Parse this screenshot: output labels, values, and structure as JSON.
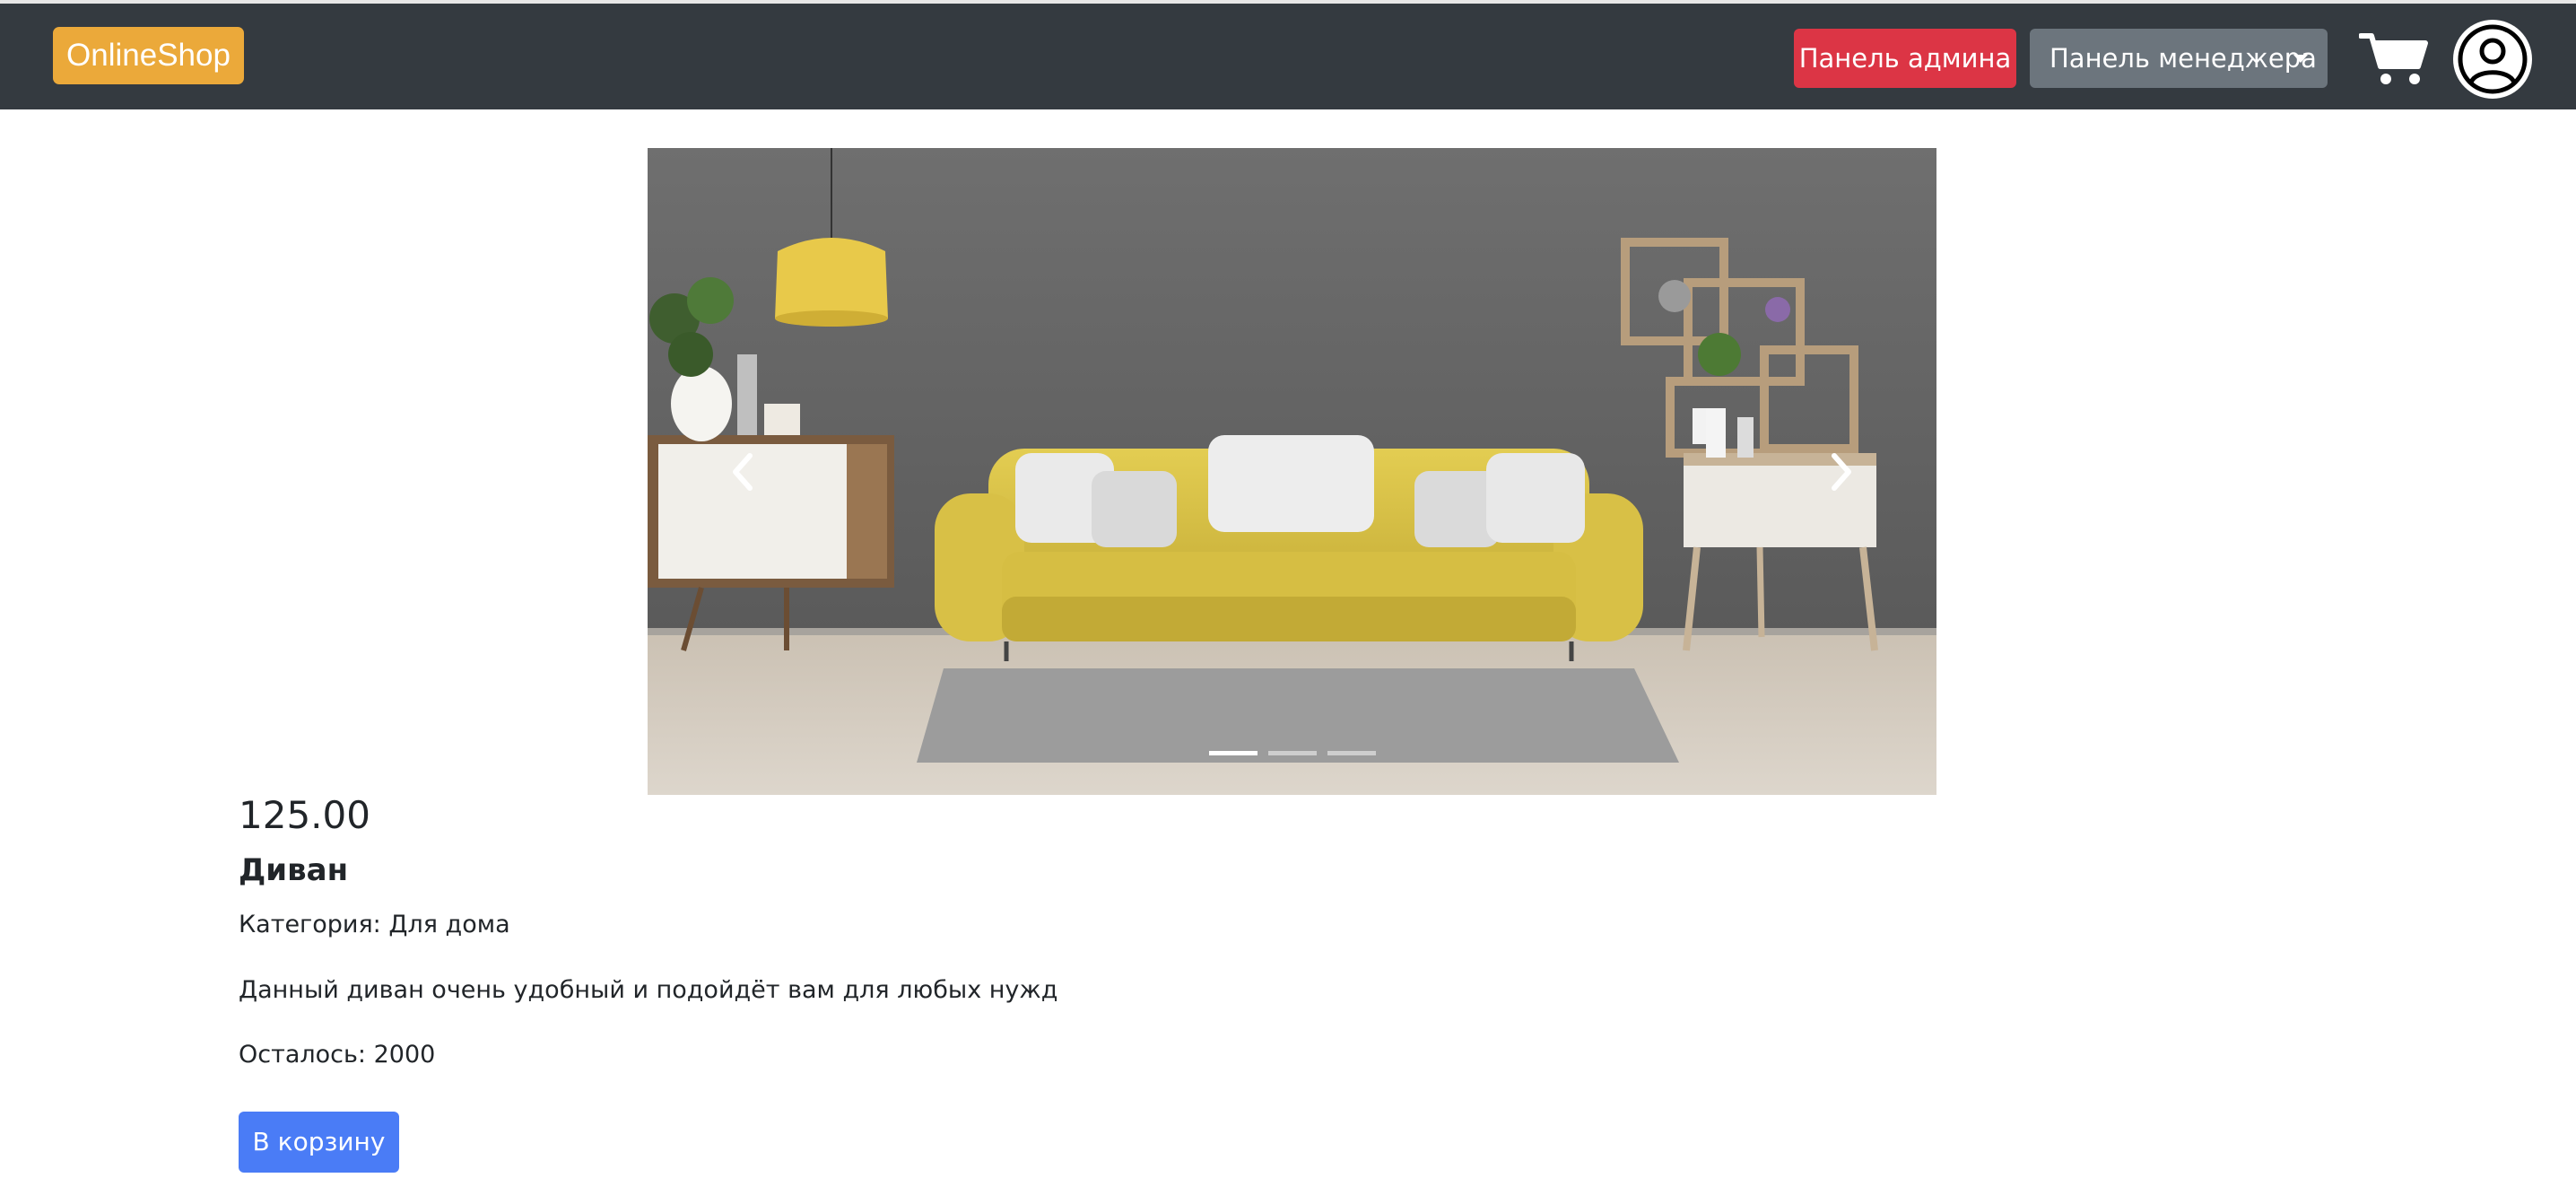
{
  "navbar": {
    "brand": "OnlineShop",
    "admin_button": "Панель админа",
    "manager_button": "Панель менеджера",
    "cart_icon": "cart-icon",
    "profile_icon": "user-circle-icon"
  },
  "carousel": {
    "slide_alt": "Диван",
    "prev_icon": "chevron-left-icon",
    "next_icon": "chevron-right-icon",
    "slide_count": 3,
    "active_slide": 1
  },
  "product": {
    "price": "125.00",
    "name": "Диван",
    "category": "Категория: Для дома",
    "description": "Данный диван очень удобный и подойдёт вам для любых нужд",
    "stock": "Осталось: 2000",
    "add_to_cart": "В корзину"
  },
  "colors": {
    "navbar_bg": "#343a40",
    "brand_bg": "#eba93a",
    "admin_btn": "#dc3545",
    "manager_btn": "#6c757d",
    "cart_btn": "#4a7cf6"
  }
}
